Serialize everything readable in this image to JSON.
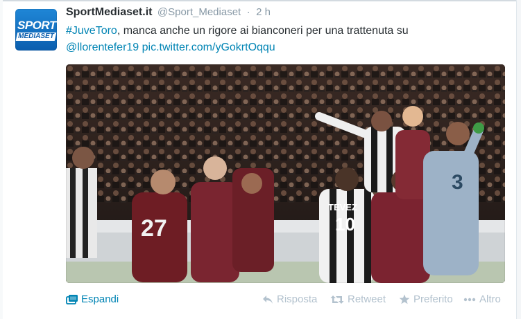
{
  "tweet": {
    "author_name": "SportMediaset.it",
    "author_handle": "@Sport_Mediaset",
    "separator": "·",
    "time": "2 h",
    "avatar_logo_top": "SPORT",
    "avatar_logo_bottom": "MEDIASET",
    "text": {
      "hashtag": "#JuveToro",
      "body_line1": ", manca anche un rigore ai bianconeri per una trattenuta su",
      "mention": "@llorentefer19",
      "media_link": "pic.twitter.com/yGokrtOqqu"
    },
    "photo_jersey_text": {
      "player1": "27",
      "player2": "TEVEZ",
      "player3": "10",
      "player4": "3"
    }
  },
  "actions": {
    "expand": "Espandi",
    "reply": "Risposta",
    "retweet": "Retweet",
    "favorite": "Preferito",
    "more": "Altro"
  },
  "colors": {
    "link": "#0084b4",
    "text": "#292f33",
    "muted": "#8899a6",
    "action_muted": "#b3c2ce",
    "brand_blue": "#0b5eae"
  },
  "icons": {
    "expand": "photo-expand-icon",
    "reply": "reply-icon",
    "retweet": "retweet-icon",
    "favorite": "star-icon",
    "more": "more-dots-icon"
  }
}
